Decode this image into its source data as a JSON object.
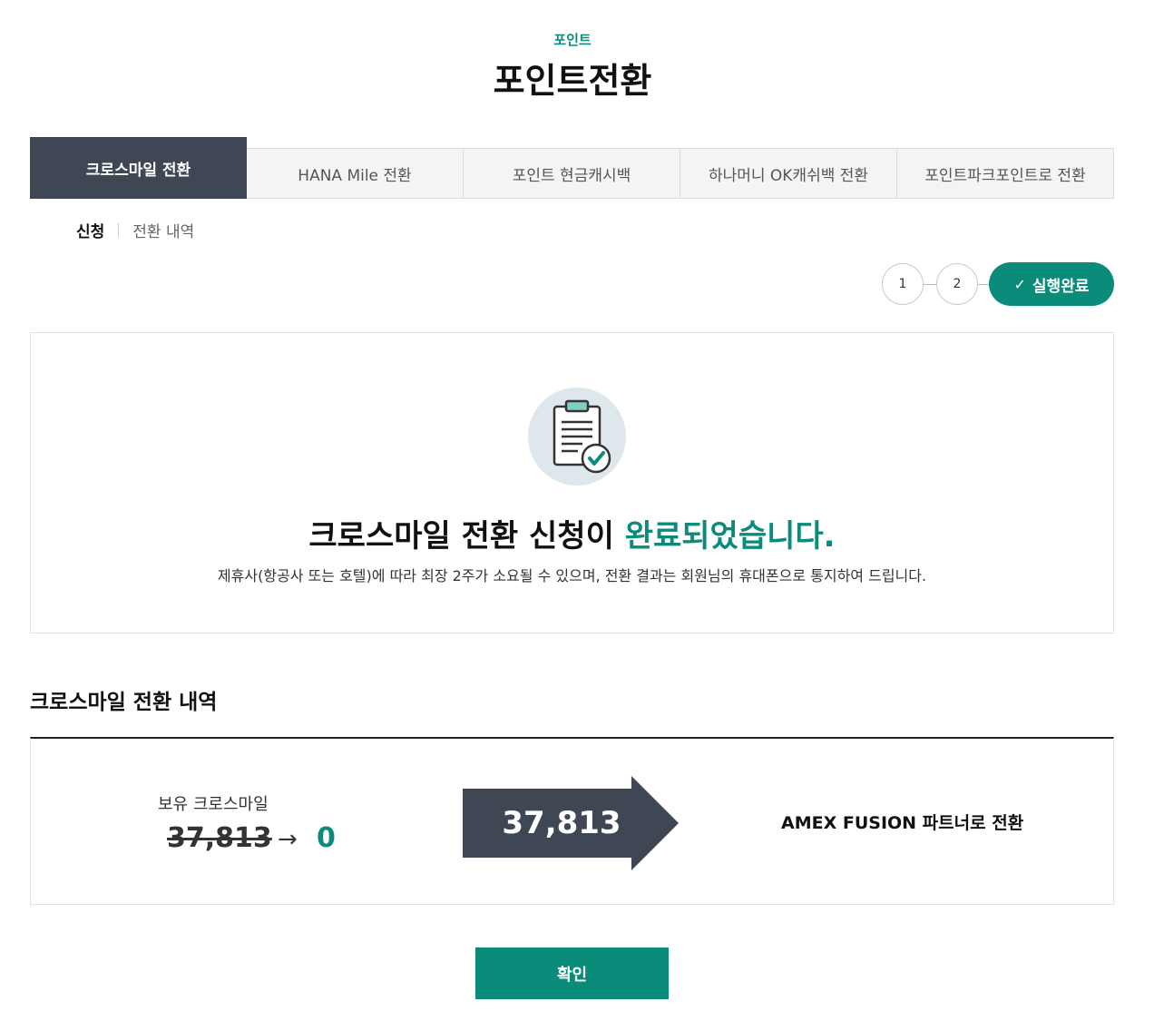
{
  "header": {
    "eyebrow": "포인트",
    "title": "포인트전환"
  },
  "tabs": [
    {
      "label": "크로스마일 전환",
      "active": true
    },
    {
      "label": "HANA Mile 전환",
      "active": false
    },
    {
      "label": "포인트 현금캐시백",
      "active": false
    },
    {
      "label": "하나머니 OK캐쉬백 전환",
      "active": false
    },
    {
      "label": "포인트파크포인트로 전환",
      "active": false
    }
  ],
  "subtabs": {
    "active": "신청",
    "other": "전환 내역"
  },
  "steps": {
    "step1": "1",
    "step2": "2",
    "done": "실행완료"
  },
  "result": {
    "message_main": "크로스마일 전환 신청이 ",
    "message_highlight": "완료되었습니다.",
    "note": "제휴사(항공사 또는 호텔)에 따라 최장 2주가 소요될 수 있으며, 전환 결과는 회원님의 휴대폰으로 통지하여 드립니다."
  },
  "history": {
    "title": "크로스마일 전환 내역",
    "held_label": "보유 크로스마일",
    "held_before": "37,813",
    "held_after": "0",
    "converted": "37,813",
    "partner": "AMEX FUSION 파트너로 전환"
  },
  "confirm_label": "확인",
  "colors": {
    "accent": "#0b8c7b",
    "dark": "#3e4753"
  }
}
